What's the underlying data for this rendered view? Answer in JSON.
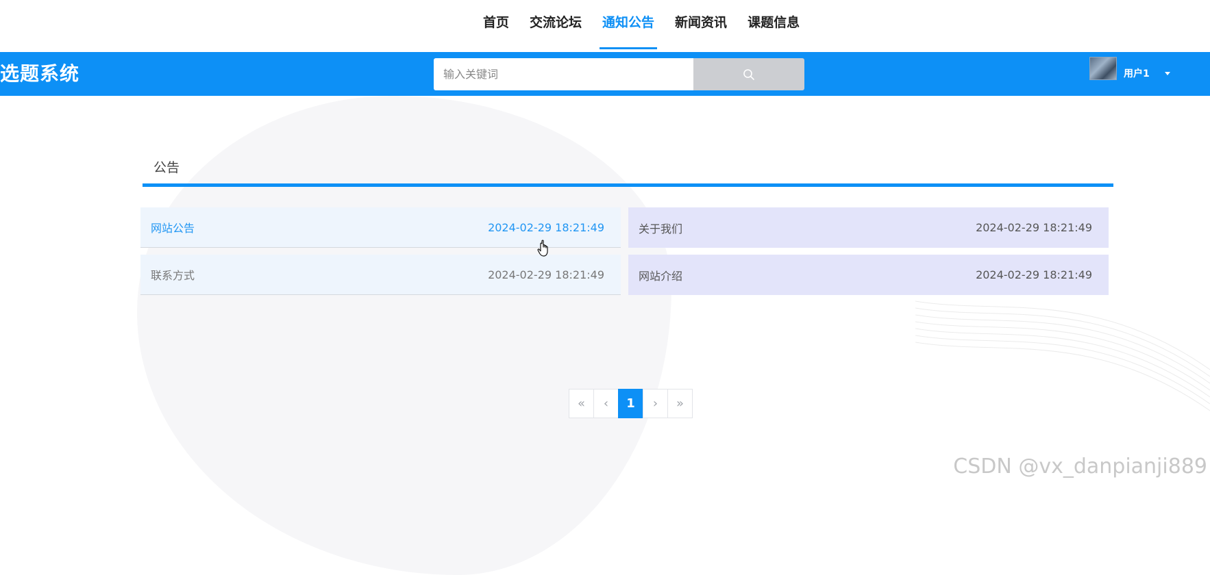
{
  "nav": {
    "items": [
      {
        "label": "首页",
        "active": false
      },
      {
        "label": "交流论坛",
        "active": false
      },
      {
        "label": "通知公告",
        "active": true
      },
      {
        "label": "新闻资讯",
        "active": false
      },
      {
        "label": "课题信息",
        "active": false
      }
    ]
  },
  "header": {
    "site_title": "选题系统",
    "search_placeholder": "输入关键词",
    "search_icon": "search-icon",
    "user_name": "用户1",
    "brand_color": "#0d90f6"
  },
  "main": {
    "section_title": "公告",
    "notices": [
      {
        "title": "网站公告",
        "date": "2024-02-29 18:21:49"
      },
      {
        "title": "关于我们",
        "date": "2024-02-29 18:21:49"
      },
      {
        "title": "联系方式",
        "date": "2024-02-29 18:21:49"
      },
      {
        "title": "网站介绍",
        "date": "2024-02-29 18:21:49"
      }
    ]
  },
  "pagination": {
    "first": "«",
    "prev": "‹",
    "current": "1",
    "next": "›",
    "last": "»"
  },
  "watermark": "CSDN @vx_danpianji889"
}
